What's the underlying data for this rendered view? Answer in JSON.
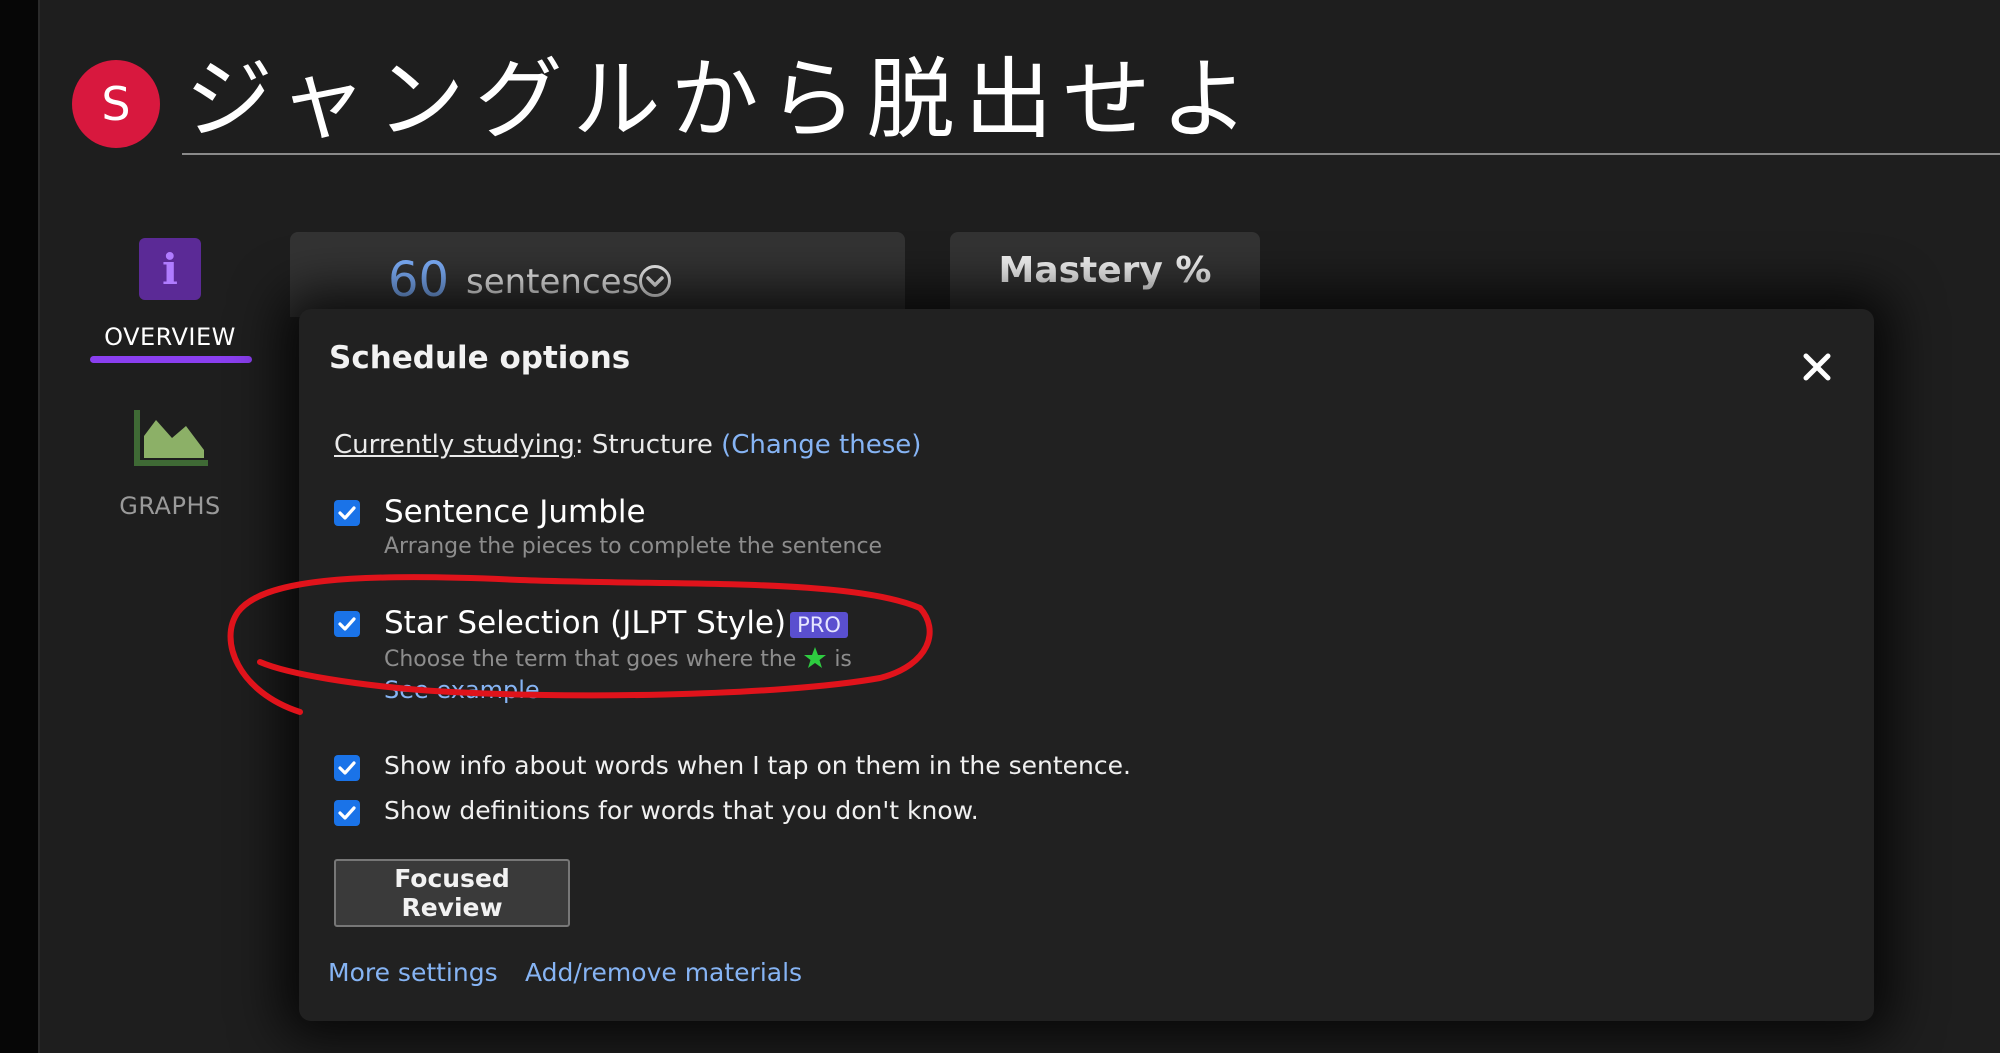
{
  "header": {
    "avatar_letter": "S",
    "title": "ジャングルから脱出せよ"
  },
  "nav": {
    "overview_label": "OVERVIEW",
    "info_icon_glyph": "i",
    "graphs_label": "GRAPHS"
  },
  "stats": {
    "sentence_count": "60",
    "sentence_unit": "sentences",
    "mastery_title": "Mastery %"
  },
  "dialog": {
    "title": "Schedule options",
    "studying_label": "Currently studying",
    "studying_sep": ":",
    "studying_value": "Structure",
    "change_link": "(Change these)",
    "options": [
      {
        "title": "Sentence Jumble",
        "desc": "Arrange the pieces to complete the sentence",
        "checked": true
      },
      {
        "title": "Star Selection (JLPT Style)",
        "badge": "PRO",
        "desc_before": "Choose the term that goes where the",
        "desc_after": "is",
        "see_example": "See example",
        "checked": true
      }
    ],
    "settings": [
      {
        "label": "Show info about words when I tap on them in the sentence.",
        "checked": true
      },
      {
        "label": "Show definitions for words that you don't know.",
        "checked": true
      }
    ],
    "focused_review_label": "Focused Review",
    "more_settings_label": "More settings",
    "materials_label": "Add/remove materials"
  },
  "colors": {
    "background": "#1e1e1e",
    "avatar": "#d8183e",
    "accent_purple": "#8a3ff0",
    "link": "#86b4f4",
    "checkbox": "#1a73e8",
    "pro_badge": "#5a4fcf",
    "star": "#2ecc40",
    "annotation_red": "#e0131b"
  }
}
